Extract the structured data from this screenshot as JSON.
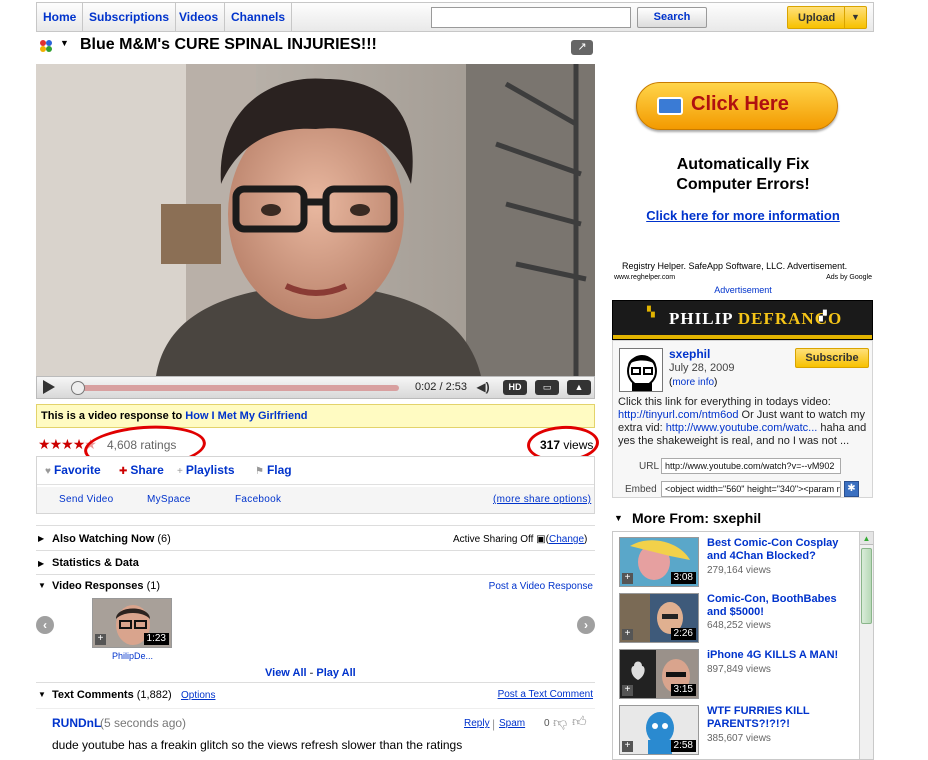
{
  "nav": {
    "home": "Home",
    "subscriptions": "Subscriptions",
    "videos": "Videos",
    "channels": "Channels",
    "search_value": "",
    "search_button": "Search",
    "upload": "Upload"
  },
  "video": {
    "title": "Blue M&M's CURE SPINAL INJURIES!!!",
    "time_current": "0:02",
    "time_total": "2:53",
    "progress_fraction": 0.006,
    "hd_label": "HD",
    "response_prefix": "This is a video response to",
    "response_link": "How I Met My Girlfriend",
    "rating_stars": 4.5,
    "ratings_count": "4,608",
    "ratings_label": "ratings",
    "views_count": "317",
    "views_label": "views"
  },
  "actions": {
    "favorite": "Favorite",
    "share": "Share",
    "playlists": "Playlists",
    "flag": "Flag",
    "send_video": "Send Video",
    "myspace": "MySpace",
    "facebook": "Facebook",
    "more_share": "(more share options)"
  },
  "sections": {
    "also_watching": "Also Watching Now",
    "also_watching_count": "(6)",
    "active_sharing": "Active Sharing Off",
    "change": "Change",
    "stats": "Statistics & Data",
    "responses": "Video Responses",
    "responses_count": "(1)",
    "post_response": "Post a Video Response",
    "response_thumb_time": "1:23",
    "response_thumb_author": "PhilipDe...",
    "view_all": "View All",
    "play_all": "Play All",
    "comments": "Text Comments",
    "comments_count": "(1,882)",
    "options": "Options",
    "post_comment": "Post a Text Comment"
  },
  "comment": {
    "author": "RUNDnL",
    "time": "(5 seconds ago)",
    "reply": "Reply",
    "spam": "Spam",
    "score": "0",
    "text": "dude youtube has a freakin glitch so the views refresh slower than the ratings"
  },
  "ad": {
    "button": "Click Here",
    "headline1": "Automatically Fix",
    "headline2": "Computer Errors!",
    "more_info": "Click here for more information",
    "sponsor": "Registry Helper. SafeApp Software, LLC. Advertisement.",
    "domain": "www.reghelper.com",
    "ads_by": "Ads by Google",
    "label": "Advertisement"
  },
  "channel": {
    "banner_first": "PHILIP ",
    "banner_last": "DEFRANCO",
    "username": "sxephil",
    "date": "July 28, 2009",
    "more_info": "more info",
    "subscribe": "Subscribe",
    "desc_1": "Click this link for everything in todays video:",
    "desc_link_1": "http://tinyurl.com/ntm6od",
    "desc_2": " Or Just want to watch my extra vid: ",
    "desc_link_2": "http://www.youtube.com/watc...",
    "desc_3": " haha and yes the shakeweight is real, and no I was not ...",
    "url_label": "URL",
    "url_value": "http://www.youtube.com/watch?v=--vM902",
    "embed_label": "Embed",
    "embed_value": "<object width=\"560\" height=\"340\"><param na"
  },
  "more_from": {
    "title": "More From: sxephil",
    "items": [
      {
        "title": "Best Comic-Con Cosplay and 4Chan Blocked?",
        "views": "279,164 views",
        "time": "3:08"
      },
      {
        "title": "Comic-Con, BoothBabes and $5000!",
        "views": "648,252 views",
        "time": "2:26"
      },
      {
        "title": "iPhone 4G KILLS A MAN!",
        "views": "897,849 views",
        "time": "3:15"
      },
      {
        "title": "WTF FURRIES KILL PARENTS?!?!?!",
        "views": "385,607 views",
        "time": "2:58"
      }
    ]
  },
  "colors": {
    "link": "#0033cc",
    "accent_yellow": "#f7c100",
    "annotation_red": "#e00000",
    "star_red": "#cc0000"
  }
}
